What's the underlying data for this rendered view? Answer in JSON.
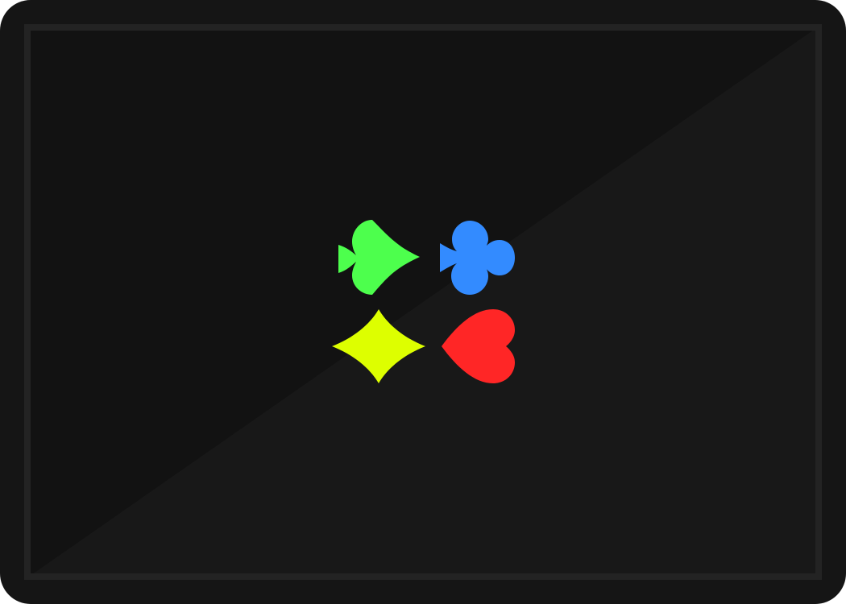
{
  "card": {
    "kind": "card-back",
    "background_color": "#151515",
    "panel_dark_color": "#121212",
    "panel_light_color": "#181818",
    "frame_color": "#232323"
  },
  "suits": [
    {
      "name": "spade",
      "icon": "spade-icon",
      "color": "#4dff4d"
    },
    {
      "name": "club",
      "icon": "club-icon",
      "color": "#338bff"
    },
    {
      "name": "diamond",
      "icon": "diamond-icon",
      "color": "#ddff00"
    },
    {
      "name": "heart",
      "icon": "heart-icon",
      "color": "#ff2626"
    }
  ]
}
